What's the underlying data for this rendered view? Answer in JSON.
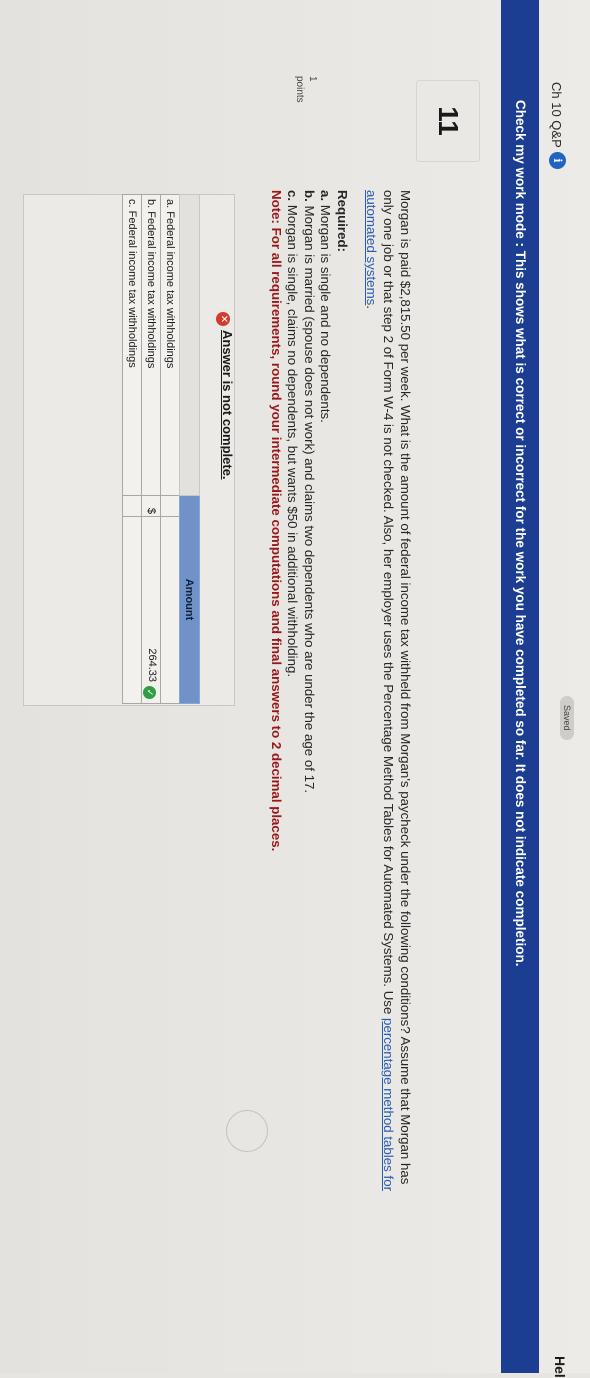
{
  "header": {
    "quiz_title": "Ch 10 Q&P",
    "info_icon": "info-icon",
    "info_glyph": "i",
    "saved_label": "Saved",
    "help_label": "Hel"
  },
  "banner": {
    "text": "Check my work mode : This shows what is correct or incorrect for the work you have completed so far. It does not indicate completion."
  },
  "question": {
    "number": "11",
    "points_value": "1",
    "points_label": "points",
    "text_before_link": "Morgan is paid $2,815.50 per week. What is the amount of federal income tax withheld from Morgan's paycheck under the following conditions? Assume that Morgan has only one job or that step 2 of Form W-4 is not checked. Also, her employer uses the Percentage Method Tables for Automated Systems. Use ",
    "link_text": "percentage method tables for automated systems",
    "text_after_link": ".",
    "required_heading": "Required:",
    "req_a_letter": "a.",
    "req_a_text": " Morgan is single and no dependents.",
    "req_b_letter": "b.",
    "req_b_text": " Morgan is married (spouse does not work) and claims two dependents who are under the age of 17.",
    "req_c_letter": "c.",
    "req_c_text": " Morgan is single, claims no dependents, but wants $50 in additional withholding.",
    "note": "Note: For all requirements, round your intermediate computations and final answers to 2 decimal places."
  },
  "answer": {
    "status_icon": "x-icon",
    "status_glyph": "✕",
    "status_text": "Answer is not complete.",
    "column_header": "Amount",
    "rows": [
      {
        "label": "a. Federal income tax withholdings",
        "currency": "",
        "value": "",
        "correct": ""
      },
      {
        "label": "b. Federal income tax withholdings",
        "currency": "$",
        "value": "264.33",
        "correct": "✓"
      },
      {
        "label": "c. Federal income tax withholdings",
        "currency": "",
        "value": "",
        "correct": ""
      }
    ]
  }
}
